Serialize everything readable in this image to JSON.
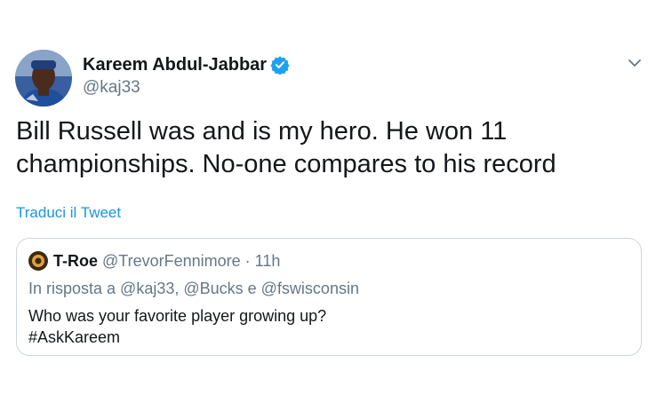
{
  "tweet": {
    "author_name": "Kareem Abdul-Jabbar",
    "author_handle": "@kaj33",
    "text_line1": "Bill Russell was and is my hero. He won 11",
    "text_line2": "championships. No-one compares to his record",
    "translate_label": "Traduci il Tweet"
  },
  "quoted": {
    "name": "T-Roe",
    "handle": "@TrevorFennimore",
    "separator": "·",
    "time": "11h",
    "reply_to": "In risposta a @kaj33, @Bucks e @fswisconsin",
    "text_line1": "Who was your favorite player growing up?",
    "text_line2": "#AskKareem"
  },
  "colors": {
    "link_blue": "#1b95e0",
    "verified_blue": "#1da1f2",
    "secondary_text": "#657786",
    "border": "#ccd6dd"
  },
  "icons": {
    "verified": "verified-badge-icon",
    "menu": "chevron-down-icon"
  }
}
